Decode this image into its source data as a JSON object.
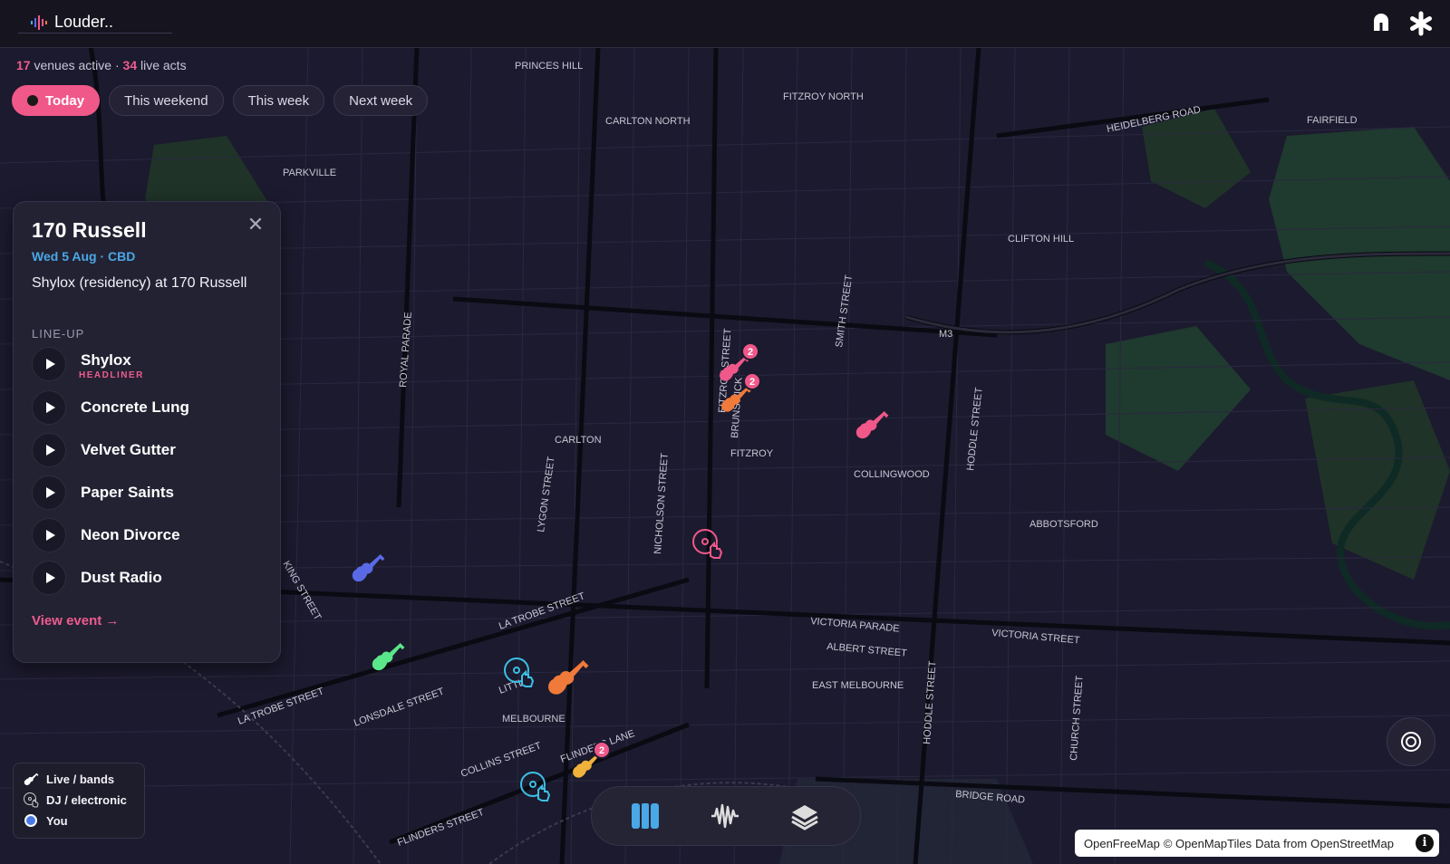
{
  "app": {
    "name": "Louder.."
  },
  "summary": {
    "venues_count": "17",
    "venues_text": "venues active ·",
    "acts_count": "34",
    "acts_text": "live acts"
  },
  "tabs": [
    {
      "label": "Today",
      "active": true
    },
    {
      "label": "This weekend",
      "active": false
    },
    {
      "label": "This week",
      "active": false
    },
    {
      "label": "Next week",
      "active": false
    }
  ],
  "venue_panel": {
    "title": "170 Russell",
    "subtitle": "Wed 5 Aug · CBD",
    "description": "Shylox (residency) at 170 Russell",
    "lineup_label": "LINE-UP",
    "lineup": [
      {
        "name": "Shylox",
        "tag": "HEADLINER"
      },
      {
        "name": "Concrete Lung"
      },
      {
        "name": "Velvet Gutter"
      },
      {
        "name": "Paper Saints"
      },
      {
        "name": "Neon Divorce"
      },
      {
        "name": "Dust Radio"
      }
    ],
    "view_event": "View event →",
    "close_icon": "close-icon"
  },
  "legend": {
    "live": "Live / bands",
    "dj": "DJ / electronic",
    "you": "You"
  },
  "map_labels": {
    "princes_hill": "PRINCES HILL",
    "fitzroy_north": "FITZROY NORTH",
    "carlton_north": "CARLTON NORTH",
    "heidelberg_road": "HEIDELBERG ROAD",
    "fairfield": "FAIRFIELD",
    "parkville": "PARKVILLE",
    "clifton_hill": "CLIFTON HILL",
    "m3": "M3",
    "smith_street": "SMITH STREET",
    "royal_parade": "ROYAL PARADE",
    "fitzroy_street": "FITZROY STREET",
    "brunswick": "BRUNSWICK",
    "hoddle_street": "HODDLE STREET",
    "carlton": "CARLTON",
    "fitzroy": "FITZROY",
    "collingwood": "COLLINGWOOD",
    "lygon_street": "LYGON STREET",
    "nicholson_street": "NICHOLSON STREET",
    "abbotsford": "ABBOTSFORD",
    "la_trobe_street": "LA TROBE STREET",
    "victoria_parade": "VICTORIA PARADE",
    "victoria_street": "VICTORIA STREET",
    "albert_street": "ALBERT STREET",
    "east_melbourne": "EAST MELBOURNE",
    "hoddle_street_2": "HODDLE STREET",
    "church_street": "CHURCH STREET",
    "lonsdale_street": "LONSDALE STREET",
    "melbourne": "MELBOURNE",
    "collins_street": "COLLINS STREET",
    "flinders_lane": "FLINDERS LANE",
    "flinders_street": "FLINDERS STREET",
    "bridge_road": "BRIDGE ROAD",
    "king_street": "KING STREET",
    "little": "LITTLE"
  },
  "markers": {
    "cluster_1": "2",
    "cluster_2": "2",
    "cluster_3": "2"
  },
  "attribution": {
    "a": "OpenFreeMap",
    "b": "© OpenMapTiles",
    "c": "Data from",
    "d": "OpenStreetMap",
    "info": "i"
  },
  "colors": {
    "accent": "#f0588a",
    "link_blue": "#4aa8e6",
    "background": "#1c1a2e"
  }
}
